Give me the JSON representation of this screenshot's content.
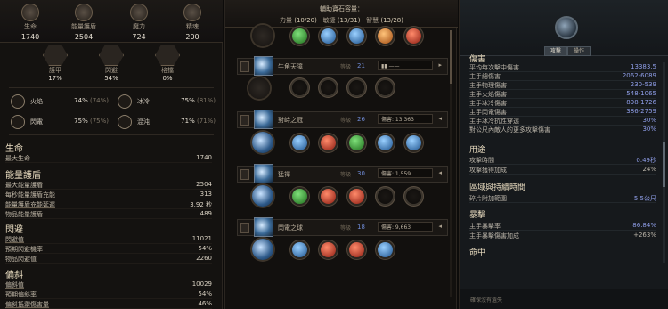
{
  "left": {
    "top_stats": [
      {
        "label": "生命",
        "value": "1740",
        "icon": "heart-icon"
      },
      {
        "label": "能量護盾",
        "value": "2504",
        "icon": "energy-shield-icon"
      },
      {
        "label": "魔力",
        "value": "724",
        "icon": "mana-icon"
      },
      {
        "label": "精魂",
        "value": "200",
        "icon": "spirit-icon"
      }
    ],
    "defense": [
      {
        "label": "護甲",
        "value": "17%",
        "icon": "armour-icon"
      },
      {
        "label": "閃避",
        "value": "54%",
        "icon": "evasion-icon"
      },
      {
        "label": "格擋",
        "value": "0%",
        "icon": "block-icon"
      }
    ],
    "resistances": [
      {
        "label": "火焰",
        "value": "74%",
        "cap": "(74%)",
        "icon": "fire-icon"
      },
      {
        "label": "冰冷",
        "value": "75%",
        "cap": "(81%)",
        "icon": "cold-icon"
      },
      {
        "label": "閃電",
        "value": "75%",
        "cap": "(75%)",
        "icon": "lightning-icon"
      },
      {
        "label": "混沌",
        "value": "71%",
        "cap": "(71%)",
        "icon": "chaos-icon"
      }
    ],
    "sections": [
      {
        "title": "生命",
        "rows": [
          {
            "label": "最大生命",
            "value": "1740"
          }
        ]
      },
      {
        "title": "能量護盾",
        "rows": [
          {
            "label": "最大能量護盾",
            "value": "2504"
          },
          {
            "label": "每秒能量護盾充能",
            "value": "313"
          },
          {
            "label": "能量護盾充能延遲",
            "value": "3.92 秒"
          },
          {
            "label": "物品能量護盾",
            "value": "489"
          }
        ]
      },
      {
        "title": "閃避",
        "rows": [
          {
            "label": "閃避值",
            "value": "11021"
          },
          {
            "label": "預期閃避機率",
            "value": "54%"
          },
          {
            "label": "物品閃避值",
            "value": "2260"
          }
        ]
      },
      {
        "title": "偏斜",
        "rows": [
          {
            "label": "偏斜值",
            "value": "10029"
          },
          {
            "label": "預期偏斜率",
            "value": "54%"
          },
          {
            "label": "偏斜抵禦傷害量",
            "value": "46%"
          }
        ]
      }
    ]
  },
  "mid": {
    "title": "輔助寶石容量：",
    "attr_prefix": "力量",
    "attr_str": "(10/20)",
    "attr_dex_label": "敏捷",
    "attr_dex": "(13/31)",
    "attr_int_label": "智慧",
    "attr_int": "(13/28)",
    "skills": [
      {
        "name": "牛角天障",
        "level_label": "等級",
        "level": "21",
        "dropdown": "——"
      },
      {
        "name": "對峙之冠",
        "level_label": "等級",
        "level": "26",
        "dropdown": "傷害: 13,363"
      },
      {
        "name": "猛禪",
        "level_label": "等級",
        "level": "30",
        "dropdown": "傷害: 1,559"
      },
      {
        "name": "閃電之球",
        "level_label": "等級",
        "level": "18",
        "dropdown": "傷害: 9,663"
      }
    ]
  },
  "right": {
    "tabs": [
      "攻擊",
      "操作"
    ],
    "sections": [
      {
        "title": "傷害",
        "rows": [
          {
            "label": "平均每次擊中傷害",
            "value": "13383.5"
          },
          {
            "label": "主手總傷害",
            "value": "2062-6089"
          },
          {
            "label": "主手物理傷害",
            "value": "230-539"
          },
          {
            "label": "主手火焰傷害",
            "value": "548-1065"
          },
          {
            "label": "主手冰冷傷害",
            "value": "898-1726"
          },
          {
            "label": "主手閃電傷害",
            "value": "386-2759"
          },
          {
            "label": "主手冰冷抗性穿透",
            "value": "30%"
          },
          {
            "label": "對公尺內敵人的更多攻擊傷害",
            "value": "30%"
          }
        ]
      },
      {
        "title": "用途",
        "rows": [
          {
            "label": "攻擊時間",
            "value": "0.49秒"
          },
          {
            "label": "攻擊獲得加成",
            "value": "24%"
          }
        ]
      },
      {
        "title": "區域與持續時間",
        "rows": [
          {
            "label": "碎片附加範圍",
            "value": "5.5公尺"
          }
        ]
      },
      {
        "title": "暴擊",
        "rows": [
          {
            "label": "主手暴擊率",
            "value": "86.84%"
          },
          {
            "label": "主手暴擊傷害加成",
            "value": "+263%"
          }
        ]
      },
      {
        "title": "命中",
        "rows": []
      }
    ],
    "footer": "確保沒有遺失"
  }
}
